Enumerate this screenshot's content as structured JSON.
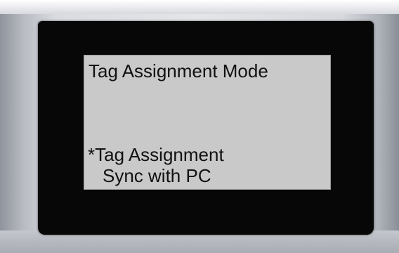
{
  "screen": {
    "title": "Tag Assignment Mode",
    "menu_items": [
      {
        "label": "*Tag Assignment",
        "selected": true
      },
      {
        "label": "Sync with PC",
        "selected": false
      }
    ]
  },
  "colors": {
    "lcd_background": "#c9c9c9",
    "bezel": "#070707",
    "text": "#111111",
    "device_body": "#dcdde1"
  }
}
